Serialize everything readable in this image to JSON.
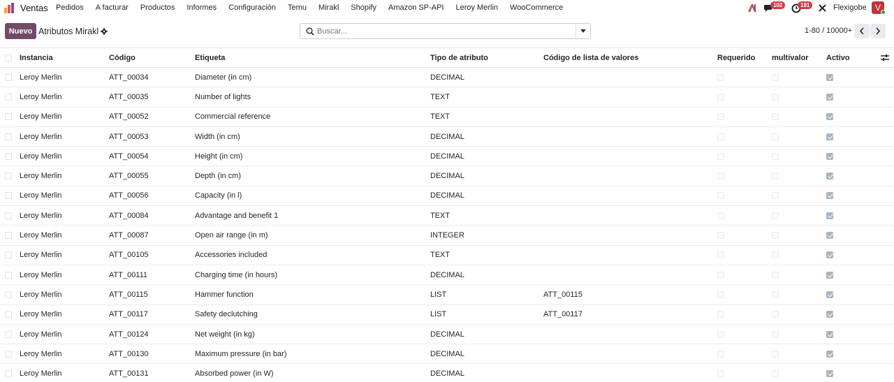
{
  "app": {
    "name": "Ventas",
    "menu": [
      "Pedidos",
      "A facturar",
      "Productos",
      "Informes",
      "Configuración",
      "Temu",
      "Mirakl",
      "Shopify",
      "Amazon SP-API",
      "Leroy Merlin",
      "WooCommerce"
    ]
  },
  "systray": {
    "chat_badge": "102",
    "activity_badge": "181",
    "company": "Flexigobe",
    "avatar_letter": "V"
  },
  "control": {
    "new_button": "Nuevo",
    "title": "Atributos Mirakl",
    "search_placeholder": "Buscar...",
    "pager": "1-80 / 10000+"
  },
  "table": {
    "headers": {
      "instance": "Instancia",
      "code": "Código",
      "label": "Etiqueta",
      "type": "Tipo de atributo",
      "list_code": "Código de lista de valores",
      "required": "Requerido",
      "multi": "multivalor",
      "active": "Activo"
    },
    "rows": [
      {
        "instance": "Leroy Merlin",
        "code": "ATT_00034",
        "label": "Diameter (in cm)",
        "type": "DECIMAL",
        "list_code": "",
        "active": true
      },
      {
        "instance": "Leroy Merlin",
        "code": "ATT_00035",
        "label": "Number of lights",
        "type": "TEXT",
        "list_code": "",
        "active": true
      },
      {
        "instance": "Leroy Merlin",
        "code": "ATT_00052",
        "label": "Commercial reference",
        "type": "TEXT",
        "list_code": "",
        "active": true
      },
      {
        "instance": "Leroy Merlin",
        "code": "ATT_00053",
        "label": "Width (in cm)",
        "type": "DECIMAL",
        "list_code": "",
        "active": true
      },
      {
        "instance": "Leroy Merlin",
        "code": "ATT_00054",
        "label": "Height (in cm)",
        "type": "DECIMAL",
        "list_code": "",
        "active": true
      },
      {
        "instance": "Leroy Merlin",
        "code": "ATT_00055",
        "label": "Depth (in cm)",
        "type": "DECIMAL",
        "list_code": "",
        "active": true
      },
      {
        "instance": "Leroy Merlin",
        "code": "ATT_00056",
        "label": "Capacity (in l)",
        "type": "DECIMAL",
        "list_code": "",
        "active": true
      },
      {
        "instance": "Leroy Merlin",
        "code": "ATT_00084",
        "label": "Advantage and benefit 1",
        "type": "TEXT",
        "list_code": "",
        "active": true
      },
      {
        "instance": "Leroy Merlin",
        "code": "ATT_00087",
        "label": "Open air range (in m)",
        "type": "INTEGER",
        "list_code": "",
        "active": true
      },
      {
        "instance": "Leroy Merlin",
        "code": "ATT_00105",
        "label": "Accessories included",
        "type": "TEXT",
        "list_code": "",
        "active": true
      },
      {
        "instance": "Leroy Merlin",
        "code": "ATT_00111",
        "label": "Charging time (in hours)",
        "type": "DECIMAL",
        "list_code": "",
        "active": true
      },
      {
        "instance": "Leroy Merlin",
        "code": "ATT_00115",
        "label": "Hammer function",
        "type": "LIST",
        "list_code": "ATT_00115",
        "active": true
      },
      {
        "instance": "Leroy Merlin",
        "code": "ATT_00117",
        "label": "Safety declutching",
        "type": "LIST",
        "list_code": "ATT_00117",
        "active": true
      },
      {
        "instance": "Leroy Merlin",
        "code": "ATT_00124",
        "label": "Net weight (in kg)",
        "type": "DECIMAL",
        "list_code": "",
        "active": true
      },
      {
        "instance": "Leroy Merlin",
        "code": "ATT_00130",
        "label": "Maximum pressure (in bar)",
        "type": "DECIMAL",
        "list_code": "",
        "active": true
      },
      {
        "instance": "Leroy Merlin",
        "code": "ATT_00131",
        "label": "Absorbed power (in W)",
        "type": "DECIMAL",
        "list_code": "",
        "active": true
      }
    ]
  },
  "colors": {
    "brand": "#714b67",
    "badge": "#dc3545",
    "avatar": "#c0343e"
  }
}
